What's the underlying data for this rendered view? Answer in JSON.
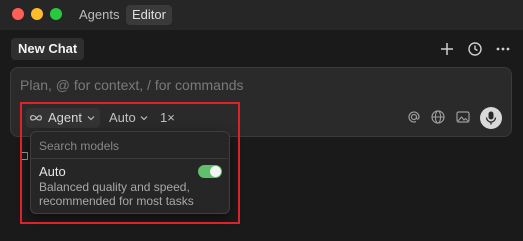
{
  "window": {
    "tabs": [
      "Agents",
      "Editor"
    ],
    "active_tab": "Editor"
  },
  "header": {
    "new_chat_label": "New Chat",
    "icons": [
      "plus-icon",
      "history-icon",
      "more-icon"
    ]
  },
  "composer": {
    "placeholder": "Plan, @ for context, / for commands",
    "mode_label": "Agent",
    "model_label": "Auto",
    "multiplier_label": "1×",
    "tool_icons": [
      "at-icon",
      "globe-icon",
      "image-icon",
      "microphone-icon"
    ]
  },
  "model_menu": {
    "search_placeholder": "Search models",
    "options": [
      {
        "title": "Auto",
        "description": "Balanced quality and speed, recommended for most tasks",
        "enabled": true
      }
    ]
  },
  "colors": {
    "highlight": "#e0202a",
    "toggle_on": "#5fbf6a"
  }
}
